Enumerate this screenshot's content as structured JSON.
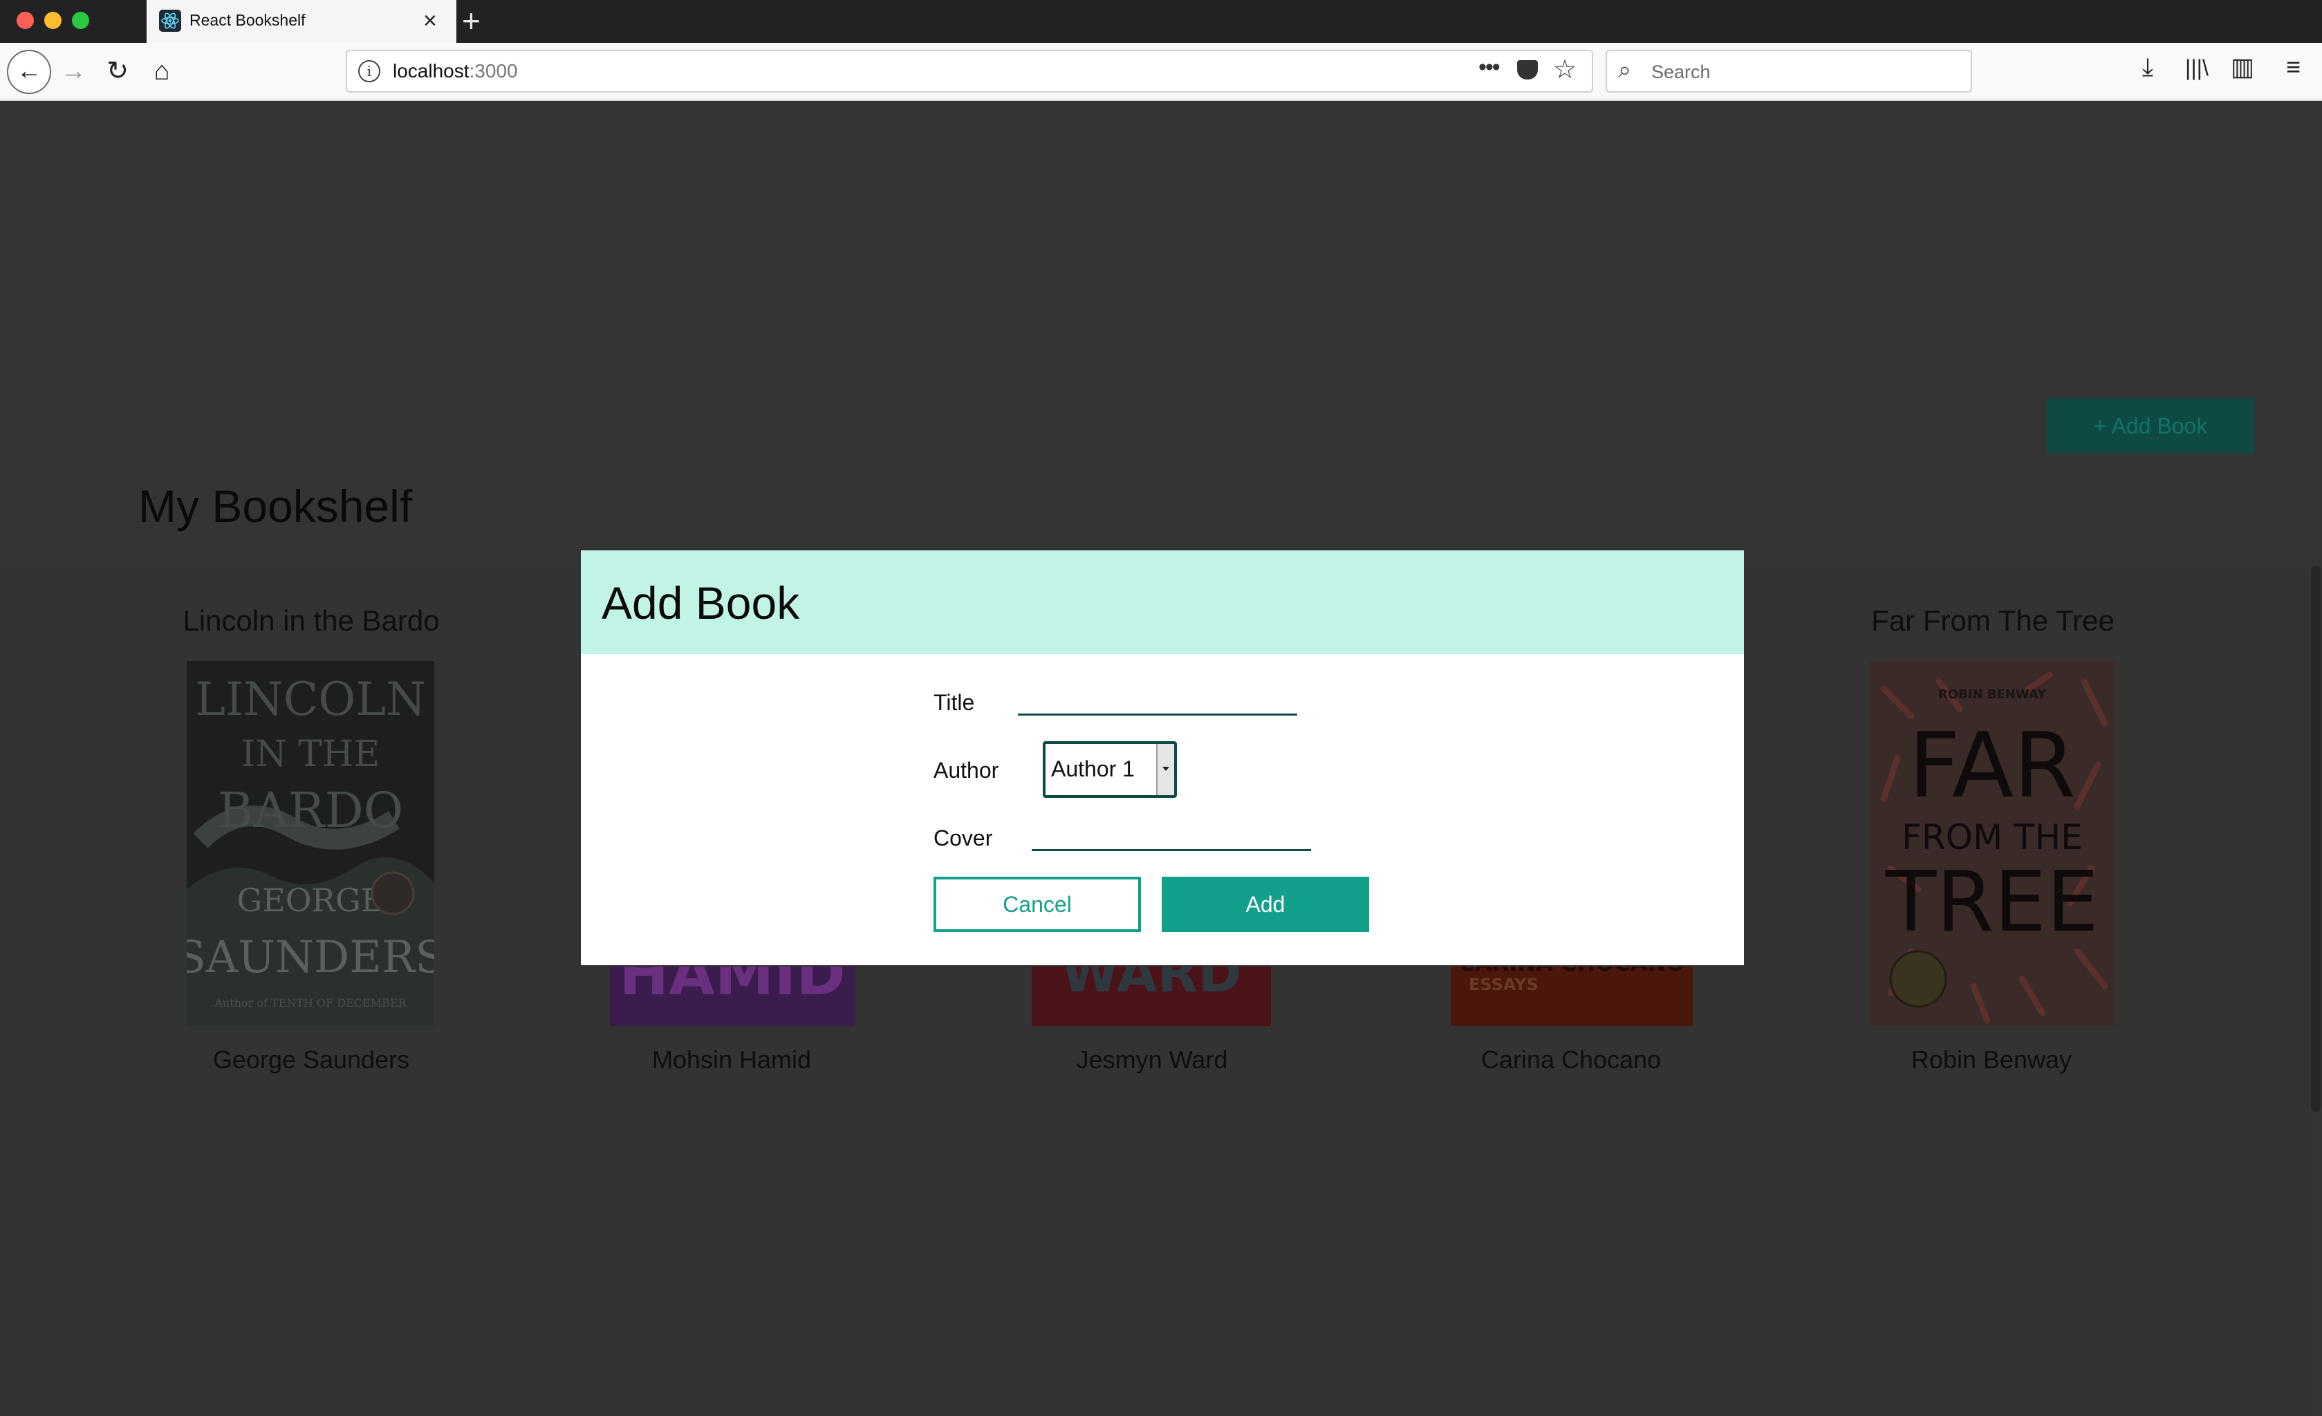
{
  "browser": {
    "tab_title": "React Bookshelf",
    "url_host": "localhost",
    "url_port": ":3000",
    "search_placeholder": "Search"
  },
  "page": {
    "add_book_button": "+ Add Book",
    "title": "My Bookshelf",
    "books": [
      {
        "title": "Lincoln in the Bardo",
        "author": "George Saunders",
        "cover_text": [
          "LINCOLN",
          "IN THE",
          "BARDO",
          "GEORGE",
          "SAUNDERS",
          "Author of TENTH OF DECEMBER"
        ]
      },
      {
        "title": "",
        "author": "Mohsin Hamid",
        "cover_text": [
          "HAMID"
        ]
      },
      {
        "title": "",
        "author": "Jesmyn Ward",
        "cover_text": [
          "WARD"
        ]
      },
      {
        "title": "",
        "author": "Carina Chocano",
        "cover_text": [
          "CARINA CHOCANO",
          "ESSAYS"
        ]
      },
      {
        "title": "Far From The Tree",
        "author": "Robin Benway",
        "cover_text": [
          "ROBIN BENWAY",
          "FAR",
          "FROM THE",
          "TREE"
        ]
      }
    ]
  },
  "modal": {
    "title": "Add Book",
    "title_label": "Title",
    "title_value": "",
    "author_label": "Author",
    "author_selected": "Author 1",
    "cover_label": "Cover",
    "cover_value": "",
    "cancel_label": "Cancel",
    "add_label": "Add"
  },
  "colors": {
    "accent": "#13a08b",
    "modal_header": "#c1f4e7",
    "overlay": "#343434"
  }
}
